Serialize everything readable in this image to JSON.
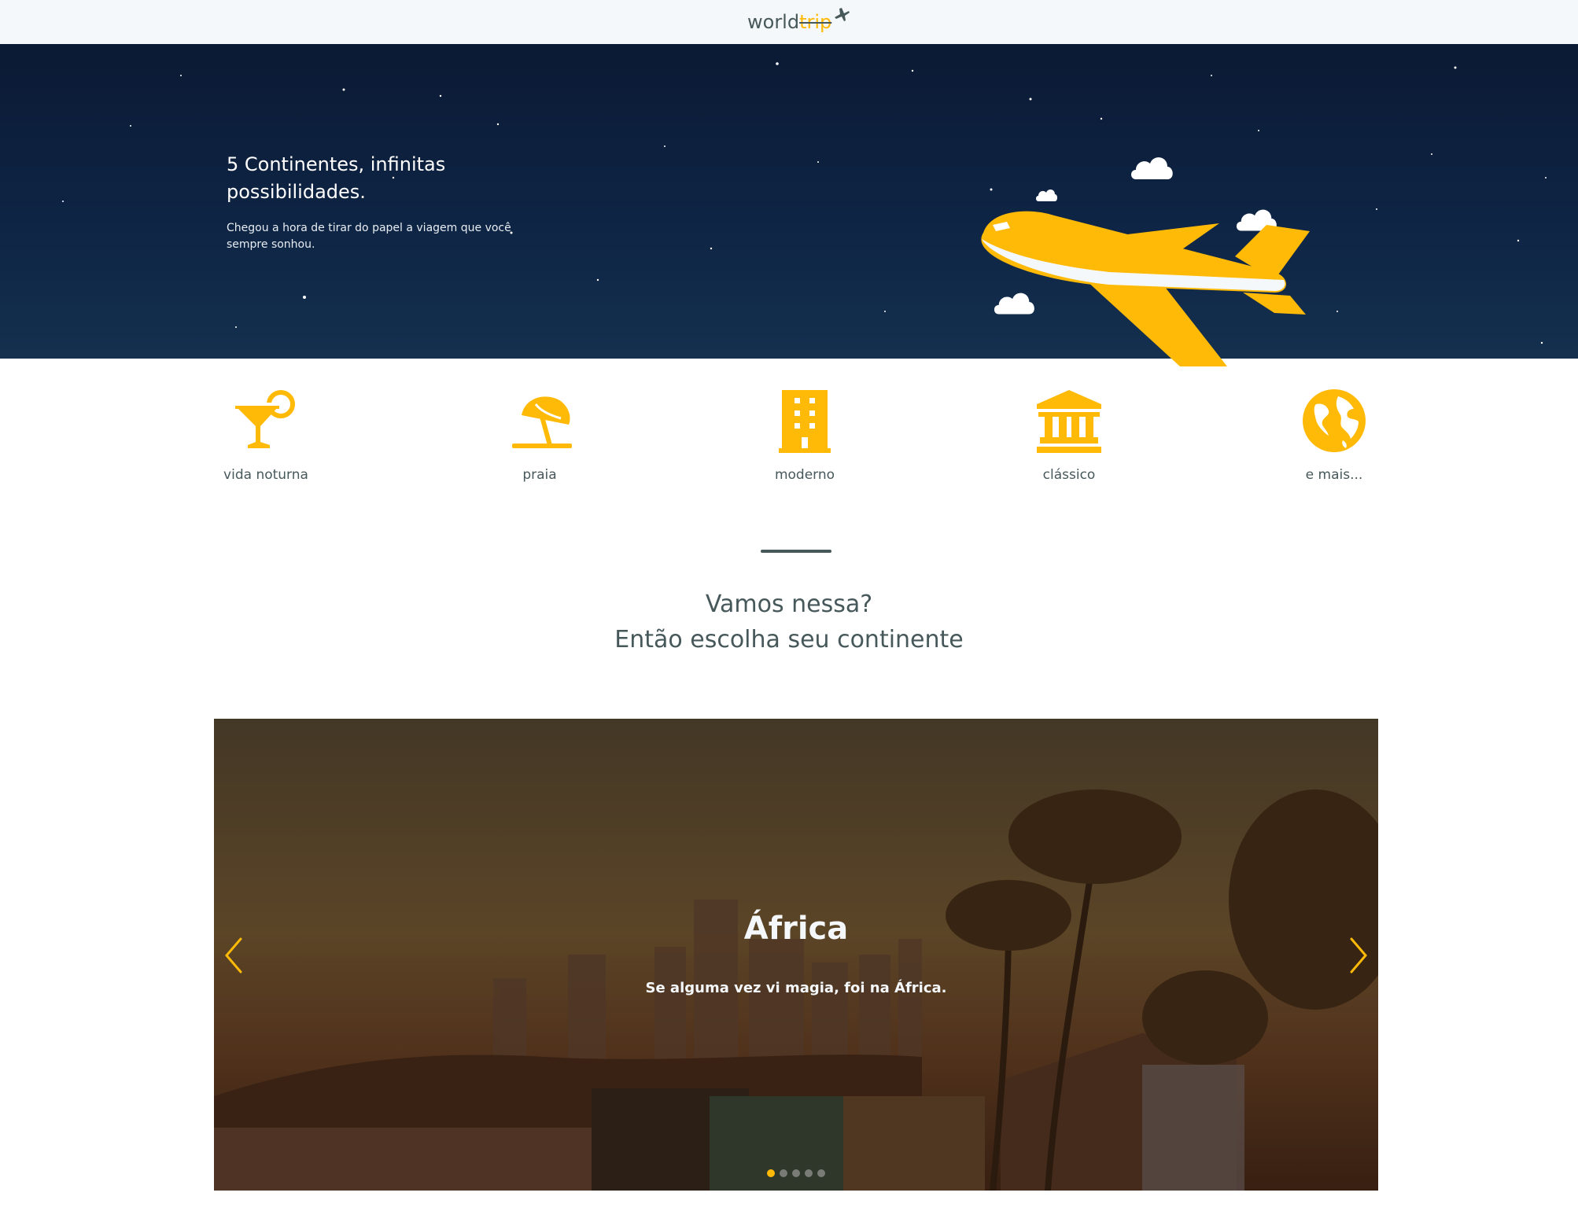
{
  "header": {
    "logo_world": "world",
    "logo_trip": "trip"
  },
  "hero": {
    "title": "5 Continentes, infinitas possibilidades.",
    "subtitle": "Chegou a hora de tirar do papel a viagem que você sempre sonhou."
  },
  "categories": [
    {
      "label": "vida noturna",
      "icon": "cocktail-icon"
    },
    {
      "label": "praia",
      "icon": "beach-umbrella-icon"
    },
    {
      "label": "moderno",
      "icon": "building-icon"
    },
    {
      "label": "clássico",
      "icon": "museum-icon"
    },
    {
      "label": "e mais...",
      "icon": "globe-icon"
    }
  ],
  "cta": {
    "line1": "Vamos nessa?",
    "line2": "Então escolha seu continente"
  },
  "slider": {
    "title": "África",
    "subtitle": "Se alguma vez vi magia, foi na África.",
    "active_slide": 1,
    "total_slides": 5
  },
  "colors": {
    "accent": "#ffba08",
    "text": "#47585b",
    "hero_bg": "#0e2444",
    "header_bg": "#f5f8fa"
  }
}
